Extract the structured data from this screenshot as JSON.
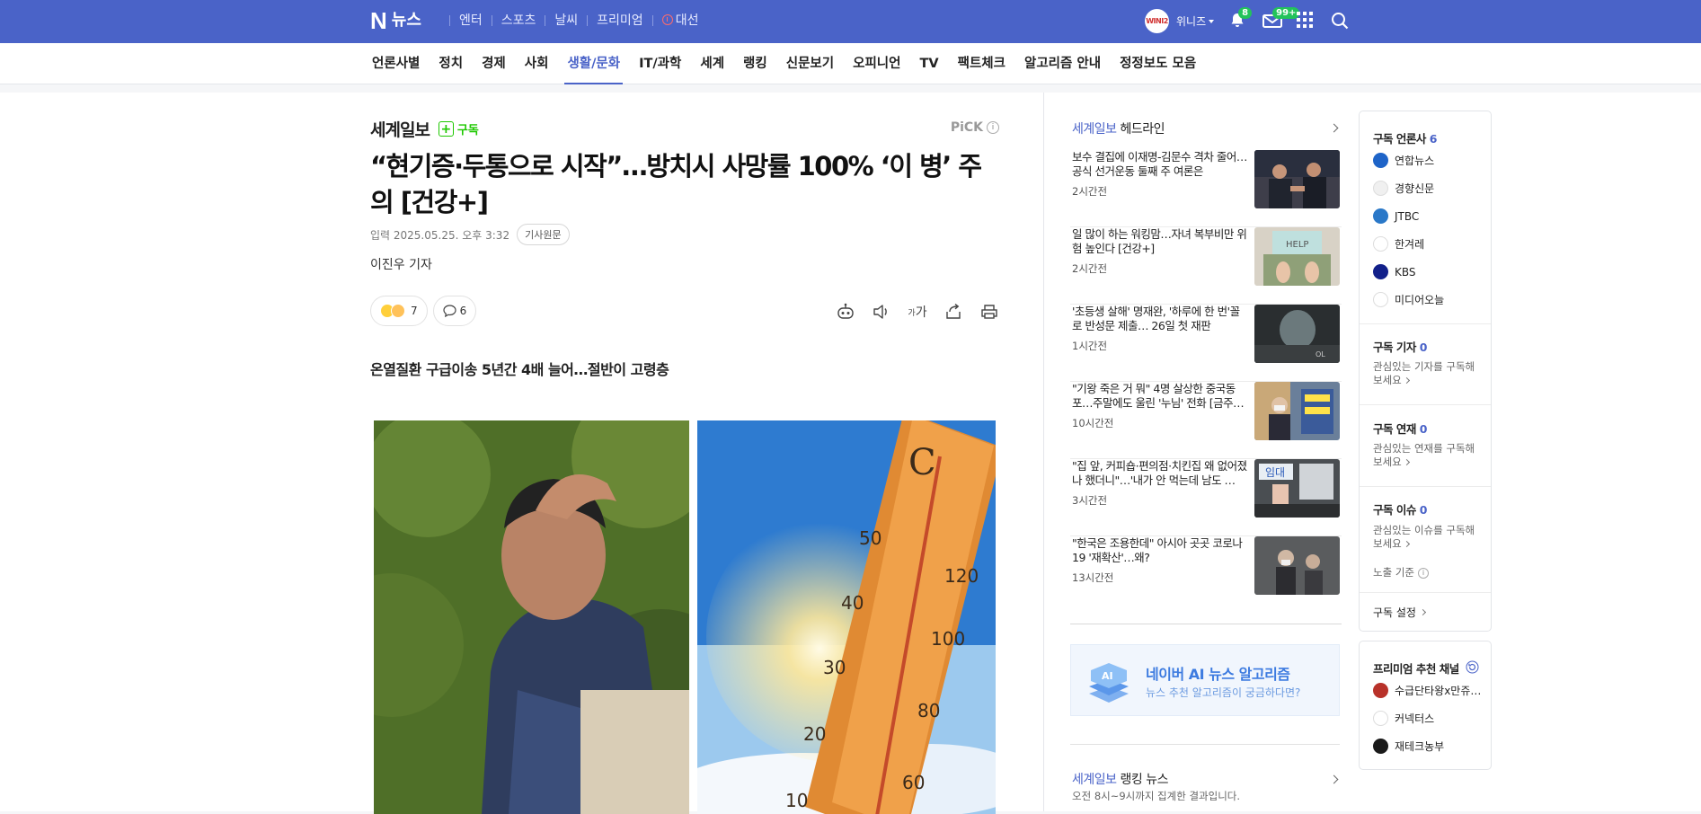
{
  "topbar": {
    "logo": "N",
    "logo_text": "뉴스",
    "nav": [
      "엔터",
      "스포츠",
      "날씨",
      "프리미엄",
      "대선"
    ],
    "avatar_text": "WINI2",
    "username": "위니즈",
    "notif_count": "8",
    "mail_count": "99+",
    "colors": {
      "bar": "#4a63c8",
      "badge": "#23c35b"
    }
  },
  "categories": [
    "언론사별",
    "정치",
    "경제",
    "사회",
    "생활/문화",
    "IT/과학",
    "세계",
    "랭킹",
    "신문보기",
    "오피니언",
    "TV",
    "팩트체크",
    "알고리즘 안내",
    "정정보도 모음"
  ],
  "active_category": "생활/문화",
  "article": {
    "press": "세계일보",
    "subscribe": "구독",
    "pick": "PiCK",
    "title": "“현기증·두통으로 시작”…방치시 사망률 100% ‘이 병’ 주의 [건강+]",
    "date": "입력 2025.05.25. 오후 3:32",
    "original_btn": "기사원문",
    "reporter": "이진우 기자",
    "reaction_count": "7",
    "comment_count": "6",
    "font_size_label": "가",
    "subheadline": "온열질환 구급이송 5년간 4배 늘어…절반이 고령층"
  },
  "headlines": {
    "press": "세계일보",
    "label": "헤드라인",
    "items": [
      {
        "title": "보수 결집에 이재명-김문수 격차 줄어…공식 선거운동 둘째 주 여론은",
        "time": "2시간전"
      },
      {
        "title": "일 많이 하는 워킹맘…자녀 복부비만 위험 높인다 [건강+]",
        "time": "2시간전"
      },
      {
        "title": "'초등생 살해' 명재완, '하루에 한 번'꼴로 반성문 제출… 26일 첫 재판",
        "time": "1시간전"
      },
      {
        "title": "\"기왕 죽은 거 뭐\" 4명 살상한 중국동포…주말에도 울린 '누님' 전화 [금주…",
        "time": "10시간전"
      },
      {
        "title": "\"집 앞, 커피숍·편의점·치킨집 왜 없어졌나 했더니\"…'내가 안 먹는데 남도 …",
        "time": "3시간전"
      },
      {
        "title": "\"한국은 조용한데\" 아시아 곳곳 코로나19 '재확산'…왜?",
        "time": "13시간전"
      }
    ]
  },
  "ai_banner": {
    "title": "네이버 AI 뉴스 알고리즘",
    "subtitle": "뉴스 추천 알고리즘이 궁금하다면?",
    "icon_text": "AI"
  },
  "ranking": {
    "press": "세계일보",
    "label": "랭킹 뉴스",
    "subtitle": "오전 8시~9시까지 집계한 결과입니다."
  },
  "subscriptions": {
    "press_label": "구독 언론사",
    "press_count": "6",
    "press_list": [
      "연합뉴스",
      "경향신문",
      "JTBC",
      "한겨레",
      "KBS",
      "미디어오늘"
    ],
    "reporter_label": "구독 기자",
    "reporter_count": "0",
    "reporter_desc": "관심있는 기자를 구독해 보세요",
    "series_label": "구독 연재",
    "series_count": "0",
    "series_desc": "관심있는 연재를 구독해 보세요",
    "issue_label": "구독 이슈",
    "issue_count": "0",
    "issue_desc": "관심있는 이슈를 구독해 보세요",
    "exposure_label": "노출 기준",
    "settings_label": "구독 설정"
  },
  "premium": {
    "label": "프리미엄 추천 채널",
    "items": [
      "수급단타왕x만쥬…",
      "커넥터스",
      "재테크농부"
    ]
  }
}
